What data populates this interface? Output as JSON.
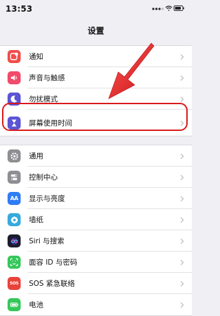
{
  "status_bar": {
    "time": "13:53"
  },
  "nav": {
    "title": "设置"
  },
  "group1": [
    {
      "label": "通知",
      "icon": "notifications-icon",
      "color": "#f04d4a"
    },
    {
      "label": "声音与触感",
      "icon": "sounds-icon",
      "color": "#f24a68"
    },
    {
      "label": "勿扰模式",
      "icon": "moon-icon",
      "color": "#5b54d4"
    },
    {
      "label": "屏幕使用时间",
      "icon": "hourglass-icon",
      "color": "#5b54d4"
    }
  ],
  "group2": [
    {
      "label": "通用",
      "icon": "gear-icon",
      "color": "#8e8e93"
    },
    {
      "label": "控制中心",
      "icon": "control-center-icon",
      "color": "#8e8e93"
    },
    {
      "label": "显示与亮度",
      "icon": "display-icon",
      "color": "#2f7cf6"
    },
    {
      "label": "墙纸",
      "icon": "wallpaper-icon",
      "color": "#36aadc"
    },
    {
      "label": "Siri 与搜索",
      "icon": "siri-icon",
      "color": "#1c1c2e"
    },
    {
      "label": "面容 ID 与密码",
      "icon": "face-id-icon",
      "color": "#34c759"
    },
    {
      "label": "SOS 紧急联络",
      "icon": "sos-icon",
      "color": "#e9423a"
    },
    {
      "label": "电池",
      "icon": "battery-icon",
      "color": "#34c759"
    }
  ],
  "icon_text": {
    "aa": "AA",
    "sos": "SOS"
  },
  "annotation": {
    "highlight_color": "#d9181b"
  }
}
